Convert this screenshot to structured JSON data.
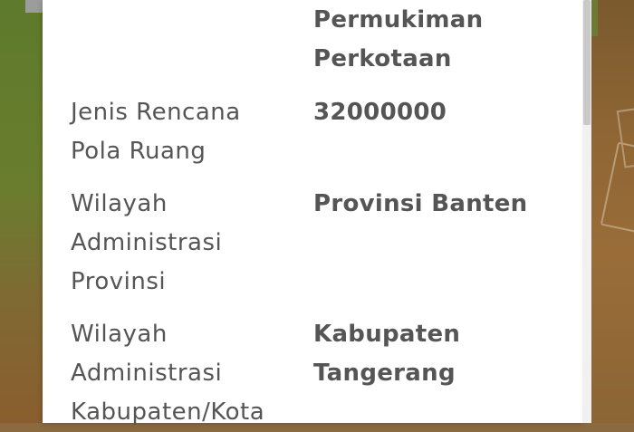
{
  "table": {
    "rows": [
      {
        "label": "",
        "value": "Permukiman Perkotaan"
      },
      {
        "label": "Jenis Rencana Pola Ruang",
        "value": "32000000"
      },
      {
        "label": "Wilayah Administrasi Provinsi",
        "value": "Provinsi Banten"
      },
      {
        "label": "Wilayah Administrasi Kabupaten/Kota",
        "value": "Kabupaten Tangerang"
      }
    ]
  },
  "colors": {
    "text": "#555555",
    "panel": "#ffffff",
    "map_green": "#5e7a2c",
    "map_brown": "#8a6a3e"
  }
}
